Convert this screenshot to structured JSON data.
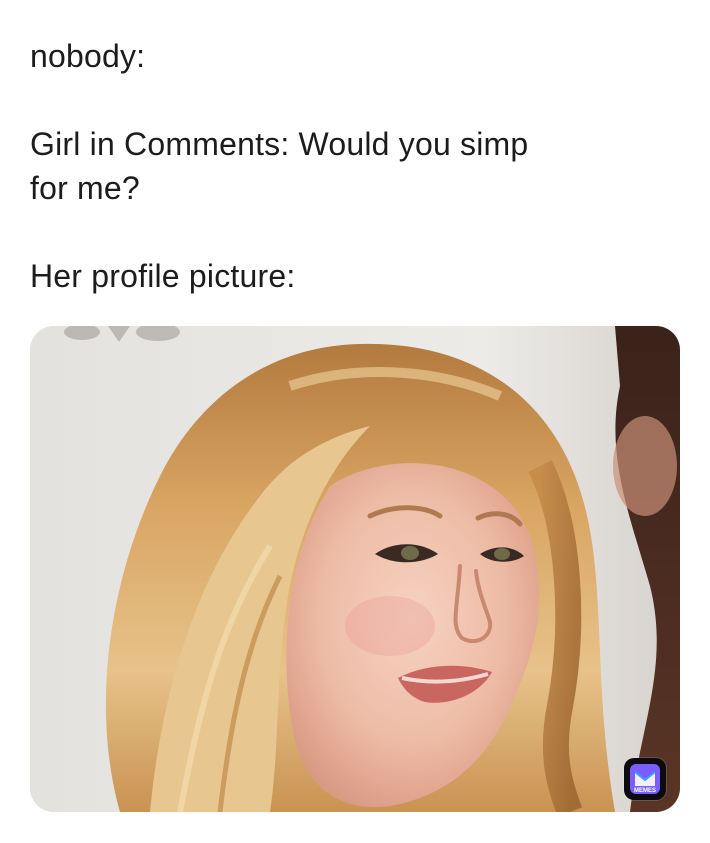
{
  "caption": {
    "line1": "nobody:",
    "line2": "Girl in Comments: Would you simp",
    "line3": "for me?",
    "line4": "Her profile picture:"
  },
  "image": {
    "icon": "woman-portrait-photo"
  },
  "watermark": {
    "text": "MEMES",
    "icon": "memes-app-logo-icon",
    "accent": "#7b5cff"
  }
}
